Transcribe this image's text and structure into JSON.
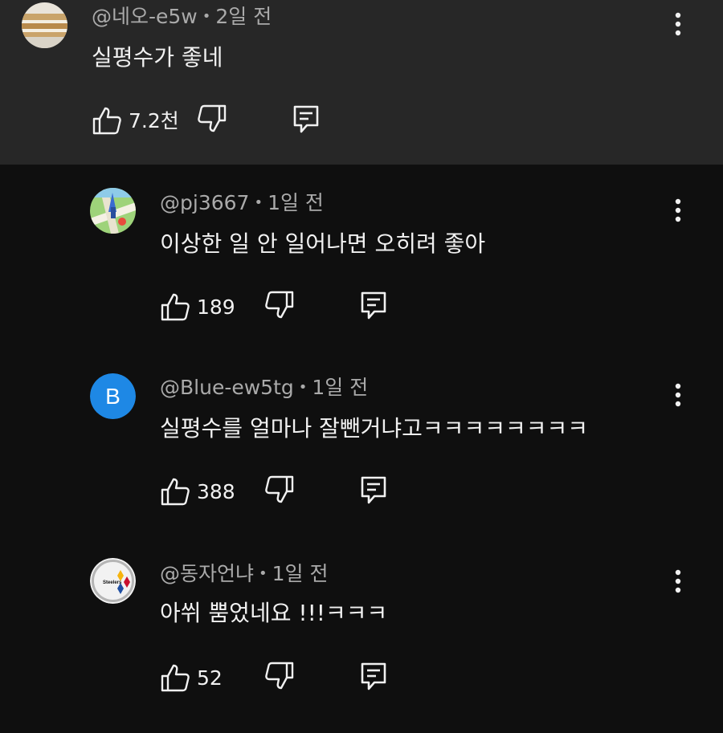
{
  "comments": [
    {
      "handle": "@네오-e5w",
      "time": "2일 전",
      "text": "실평수가 좋네",
      "likes": "7.2천",
      "avatar": "photo-icon"
    },
    {
      "handle": "@pj3667",
      "time": "1일 전",
      "text": "이상한 일 안 일어나면 오히려 좋아",
      "likes": "189",
      "avatar": "map-icon"
    },
    {
      "handle": "@Blue-ew5tg",
      "time": "1일 전",
      "text": "실평수를 얼마나 잘뺀거냐고ㅋㅋㅋㅋㅋㅋㅋㅋ",
      "likes": "388",
      "avatar_letter": "B",
      "avatar_color": "#1e88e5"
    },
    {
      "handle": "@동자언냐",
      "time": "1일 전",
      "text": "아쒸 뿜었네요 !!!ㅋㅋㅋ",
      "likes": "52",
      "avatar": "steelers-logo",
      "avatar_logo_text": "Steelers"
    }
  ],
  "separator": "•",
  "colors": {
    "page_bg": "#0f0f0f",
    "parent_bg": "#272727",
    "primary_text": "#f1f1f1",
    "secondary_text": "#aaaaaa"
  }
}
